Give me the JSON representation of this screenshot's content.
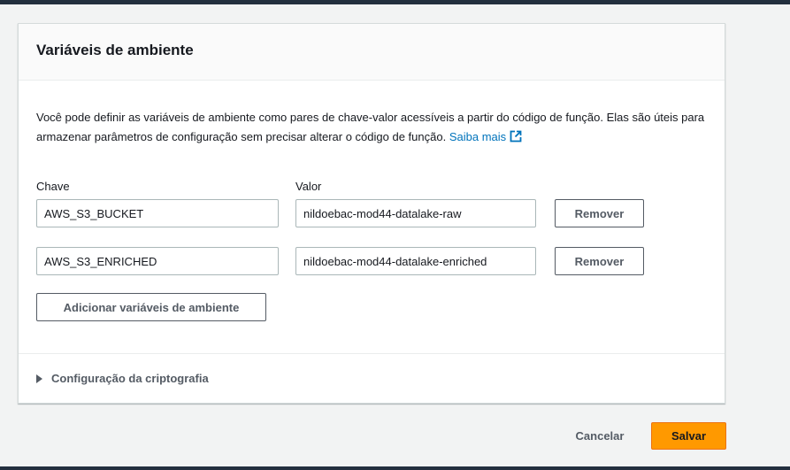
{
  "panel": {
    "title": "Variáveis de ambiente",
    "description": "Você pode definir as variáveis de ambiente como pares de chave-valor acessíveis a partir do código de função. Elas são úteis para armazenar parâmetros de configuração sem precisar alterar o código de função.",
    "learn_more_label": "Saiba mais",
    "key_column_label": "Chave",
    "value_column_label": "Valor",
    "variables": [
      {
        "key": "AWS_S3_BUCKET",
        "value": "nildoebac-mod44-datalake-raw",
        "remove_label": "Remover"
      },
      {
        "key": "AWS_S3_ENRICHED",
        "value": "nildoebac-mod44-datalake-enriched",
        "remove_label": "Remover"
      }
    ],
    "add_button_label": "Adicionar variáveis de ambiente",
    "encryption_section_label": "Configuração da criptografia"
  },
  "footer": {
    "cancel_label": "Cancelar",
    "save_label": "Salvar"
  },
  "colors": {
    "link": "#0073bb",
    "primary_button": "#ff9900",
    "nav_bar": "#232f3e"
  },
  "icons": {
    "external_link": "external-link-icon",
    "expand": "caret-right-icon"
  }
}
